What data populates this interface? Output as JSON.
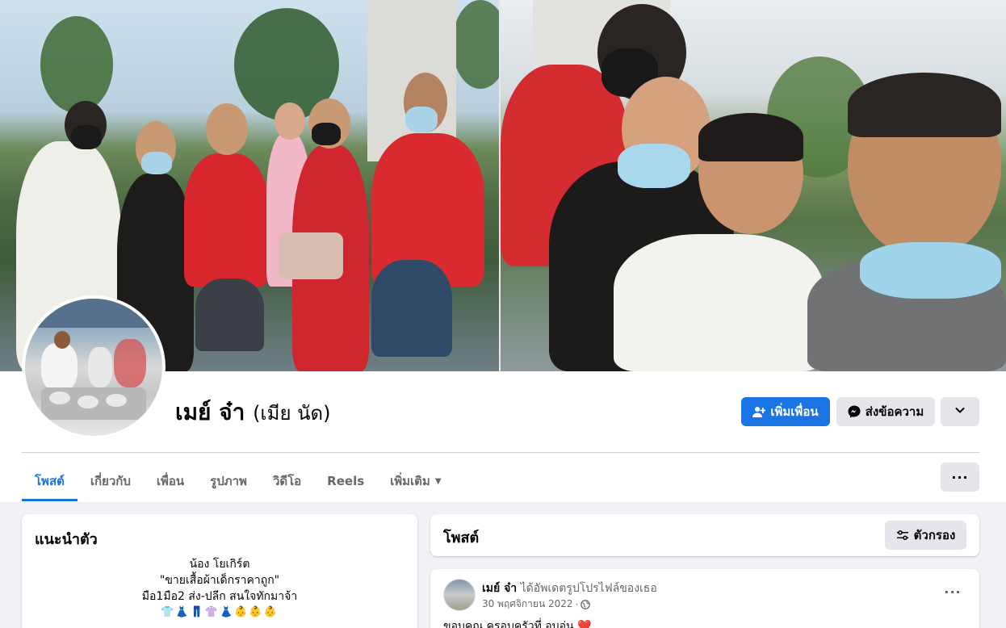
{
  "profile": {
    "name": "เมย์ จ๋า",
    "alternate_name": "(เมีย นัด)",
    "add_friend_label": "เพิ่มเพื่อน",
    "message_label": "ส่งข้อความ"
  },
  "tabs": [
    {
      "label": "โพสต์"
    },
    {
      "label": "เกี่ยวกับ"
    },
    {
      "label": "เพื่อน"
    },
    {
      "label": "รูปภาพ"
    },
    {
      "label": "วิดีโอ"
    },
    {
      "label": "Reels"
    },
    {
      "label": "เพิ่มเติม"
    }
  ],
  "intro": {
    "title": "แนะนำตัว",
    "lines": [
      "น้อง โยเกิร์ต",
      "\"ขายเสื้อผ้าเด็กราคาถูก\"",
      "มือ1มือ2 ส่ง-ปลีก สนใจทักมาจ้า",
      "👕👗👖👚👗👶👶👶"
    ]
  },
  "posts_section": {
    "title": "โพสต์",
    "filter_label": "ตัวกรอง"
  },
  "post": {
    "author": "เมย์ จ๋า",
    "action": "ได้อัพเดตรูปโปรไฟล์ของเธอ",
    "date": "30 พฤศจิกายน 2022",
    "separator": "·",
    "text": "ขอบคุณ ครอบครัวที่ อบอุ่น ❤️"
  },
  "colors": {
    "accent": "#1b74e4",
    "background": "#f0f2f5",
    "secondary_button": "#e4e6eb"
  },
  "icons": {
    "add_friend": "user-plus-icon",
    "message": "messenger-icon",
    "dropdown": "chevron-down-icon",
    "more": "ellipsis-icon",
    "filter": "sliders-icon",
    "privacy": "globe-icon"
  }
}
